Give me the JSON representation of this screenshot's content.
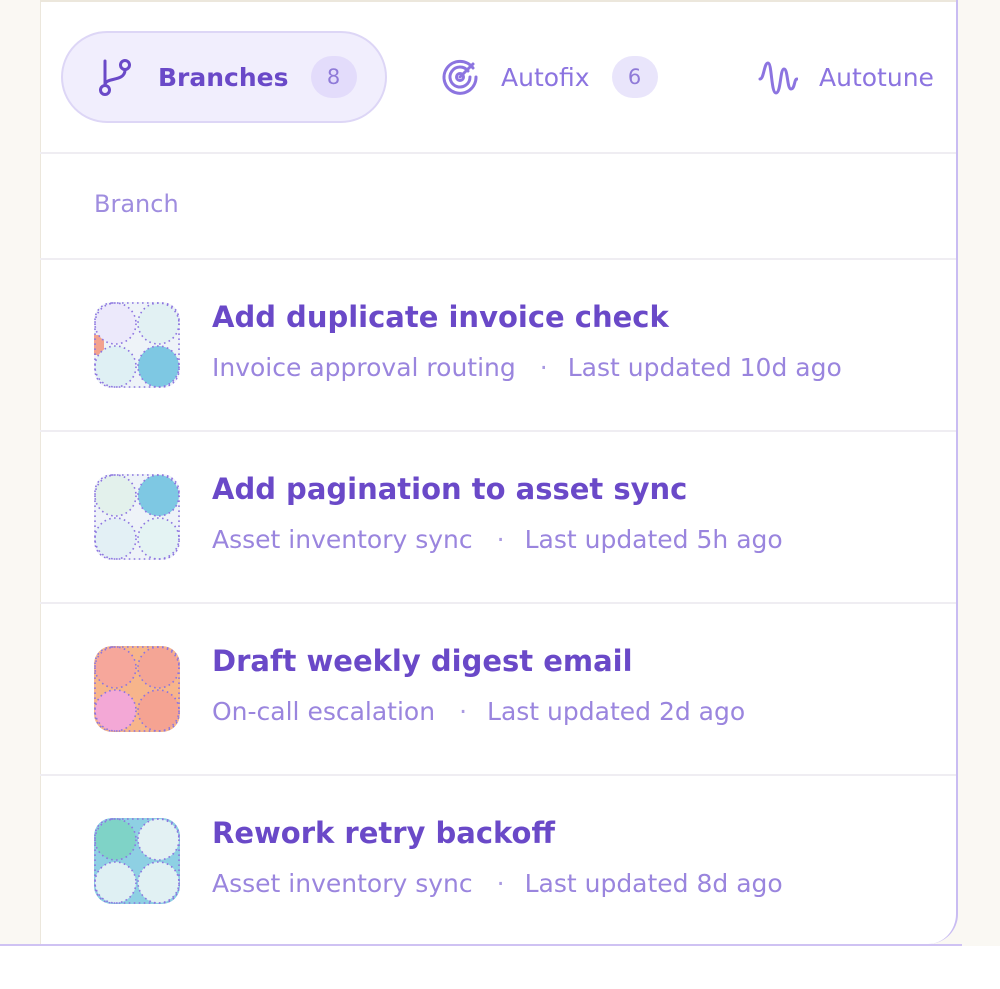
{
  "tabs": [
    {
      "label": "Branches",
      "count": "8",
      "icon": "git-branch-icon",
      "active": true
    },
    {
      "label": "Autofix",
      "count": "6",
      "icon": "radar-icon",
      "active": false
    },
    {
      "label": "Autotune",
      "icon": "waveform-icon",
      "active": false
    }
  ],
  "table": {
    "column_header": "Branch",
    "rows": [
      {
        "title": "Add duplicate invoice check",
        "project": "Invoice approval routing",
        "updated": "Last updated 10d ago",
        "avatar": {
          "colors": [
            "#ece9fb",
            "#e2f1f3",
            "#dff0f4",
            "#7ec8e3"
          ],
          "accent": "#f3a28e"
        }
      },
      {
        "title": "Add pagination to asset sync",
        "project": "Asset inventory sync",
        "updated": "Last updated 5h ago",
        "avatar": {
          "colors": [
            "#e3f1ec",
            "#7ec8e3",
            "#e3f0f5",
            "#e4f3f3"
          ]
        }
      },
      {
        "title": "Draft weekly digest email",
        "project": "On-call escalation",
        "updated": "Last updated 2d ago",
        "avatar": {
          "colors": [
            "#f6a79b",
            "#f4a595",
            "#f3a8d6",
            "#f5a392"
          ],
          "bg": "#f7b58b"
        }
      },
      {
        "title": "Rework retry backoff",
        "project": "Asset inventory sync",
        "updated": "Last updated 8d ago",
        "avatar": {
          "colors": [
            "#7fd3c7",
            "#e3f1f3",
            "#dff0f3",
            "#e1f1f3"
          ],
          "bg": "#8ed0e3"
        }
      }
    ]
  },
  "colors": {
    "accent": "#6a49c8",
    "muted": "#9a85de",
    "tab_active_bg": "#f1eefd",
    "panel_border": "#c9bcf2"
  }
}
